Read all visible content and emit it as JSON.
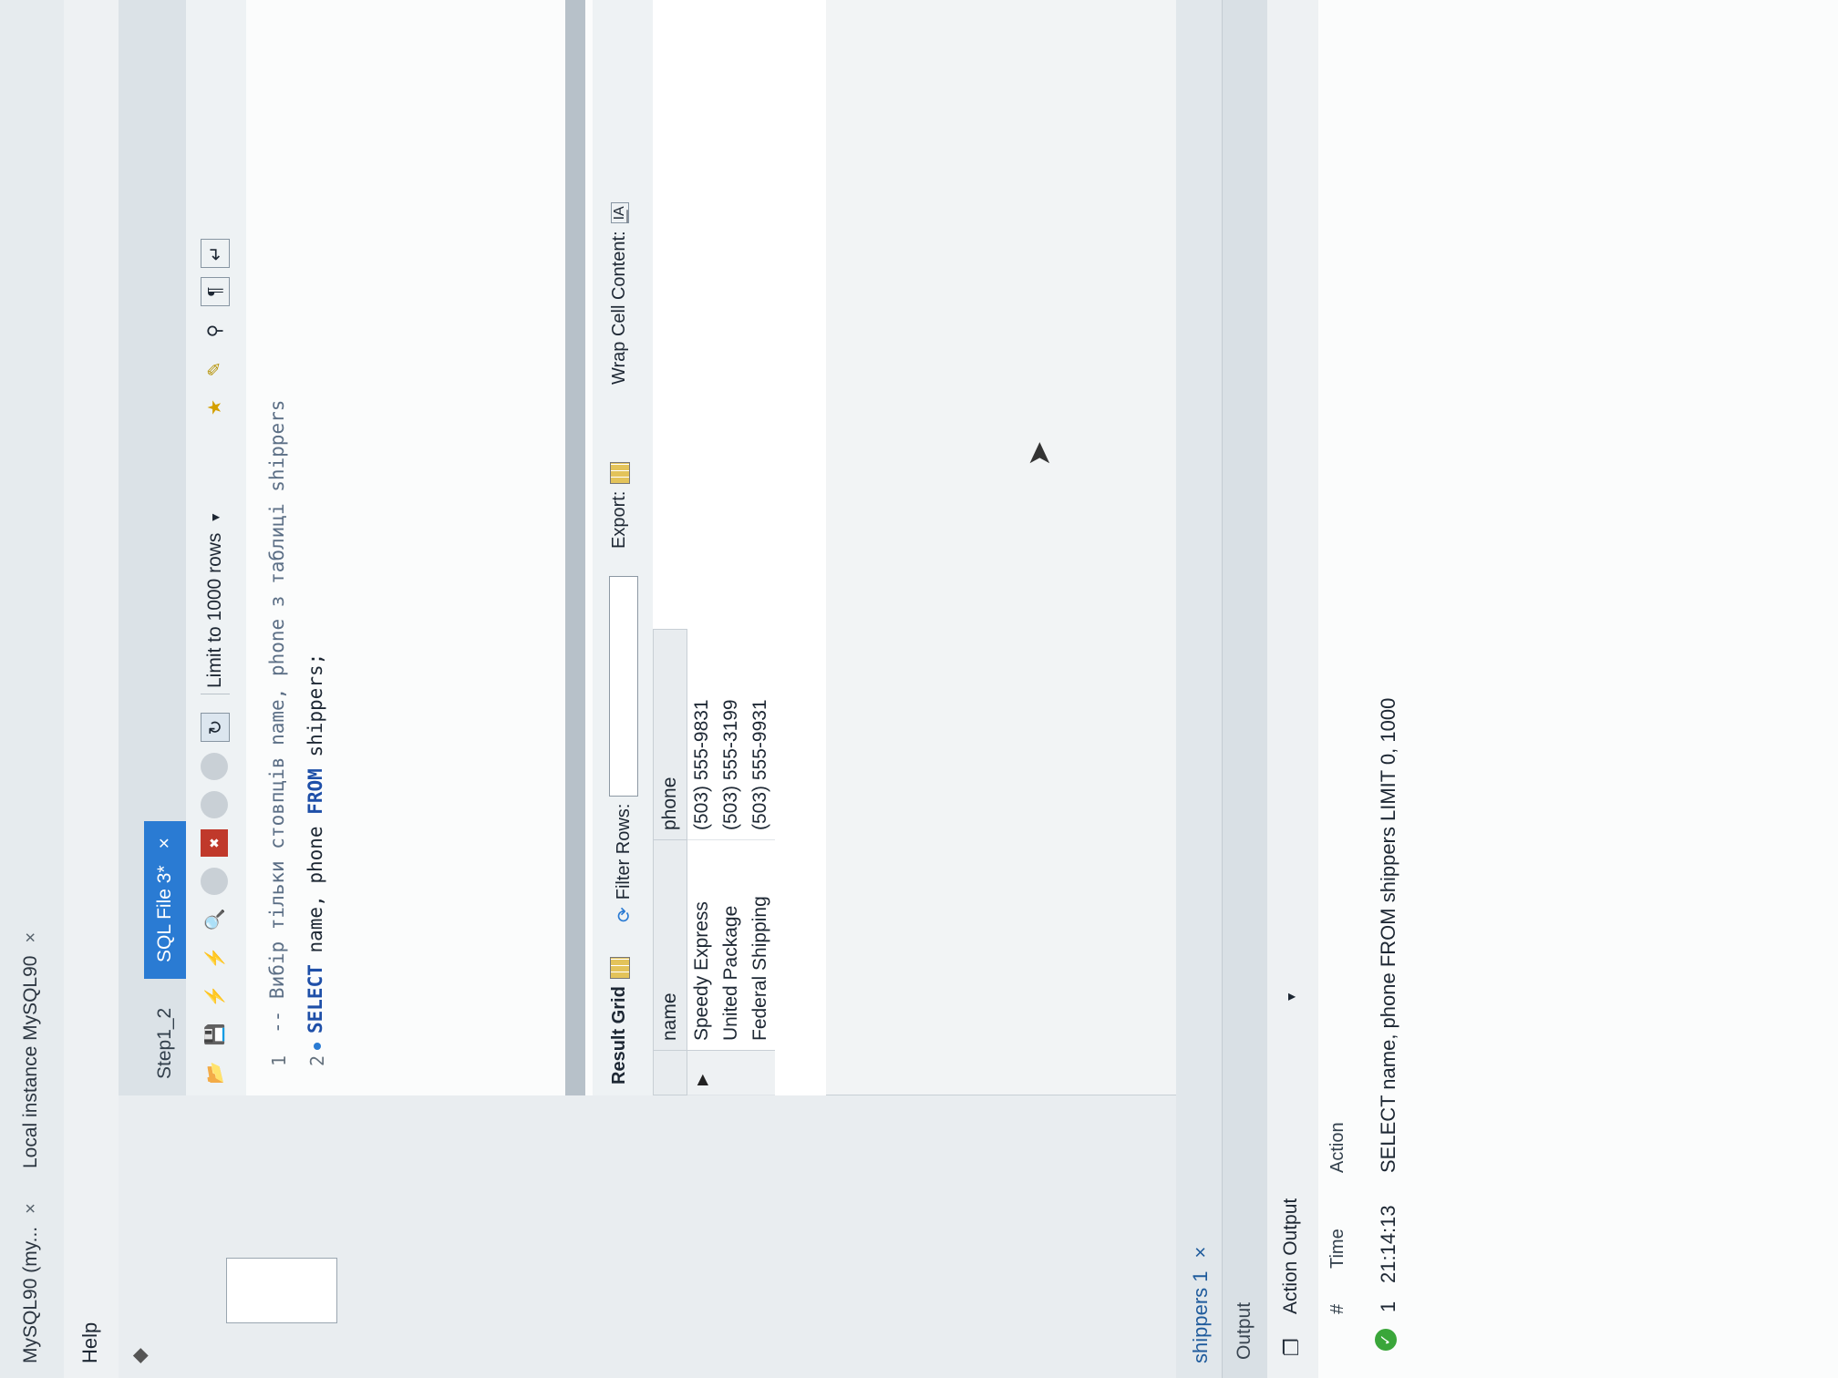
{
  "app_tabs": [
    {
      "label": "MySQL90 (my...",
      "close": "×"
    },
    {
      "label": "Local instance MySQL90",
      "close": "×"
    }
  ],
  "menu": {
    "help": "Help"
  },
  "file_tabs": {
    "step": "Step1_2",
    "sql": "SQL File 3*",
    "sql_close": "×"
  },
  "toolbar": {
    "limit": "Limit to 1000 rows"
  },
  "editor": {
    "lines": [
      {
        "num": "1",
        "text": "-- Вибір тільки стовпців name, phone з таблиці shippers"
      },
      {
        "num": "2",
        "kw1": "SELECT",
        "mid": " name, phone ",
        "kw2": "FROM",
        "tail": " shippers;"
      }
    ]
  },
  "result_bar": {
    "grid": "Result Grid",
    "filter": "Filter Rows:",
    "export": "Export:",
    "wrap": "Wrap Cell Content:"
  },
  "grid": {
    "columns": [
      "name",
      "phone"
    ],
    "rows": [
      [
        "Speedy Express",
        "(503) 555-9831"
      ],
      [
        "United Package",
        "(503) 555-3199"
      ],
      [
        "Federal Shipping",
        "(503) 555-9931"
      ]
    ]
  },
  "result_tab": {
    "label": "shippers 1",
    "close": "×"
  },
  "output": {
    "title": "Output",
    "action_output": "Action Output",
    "headers": {
      "num": "#",
      "time": "Time",
      "action": "Action"
    },
    "row": {
      "num": "1",
      "time": "21:14:13",
      "action": "SELECT name, phone FROM shippers LIMIT 0, 1000"
    }
  }
}
